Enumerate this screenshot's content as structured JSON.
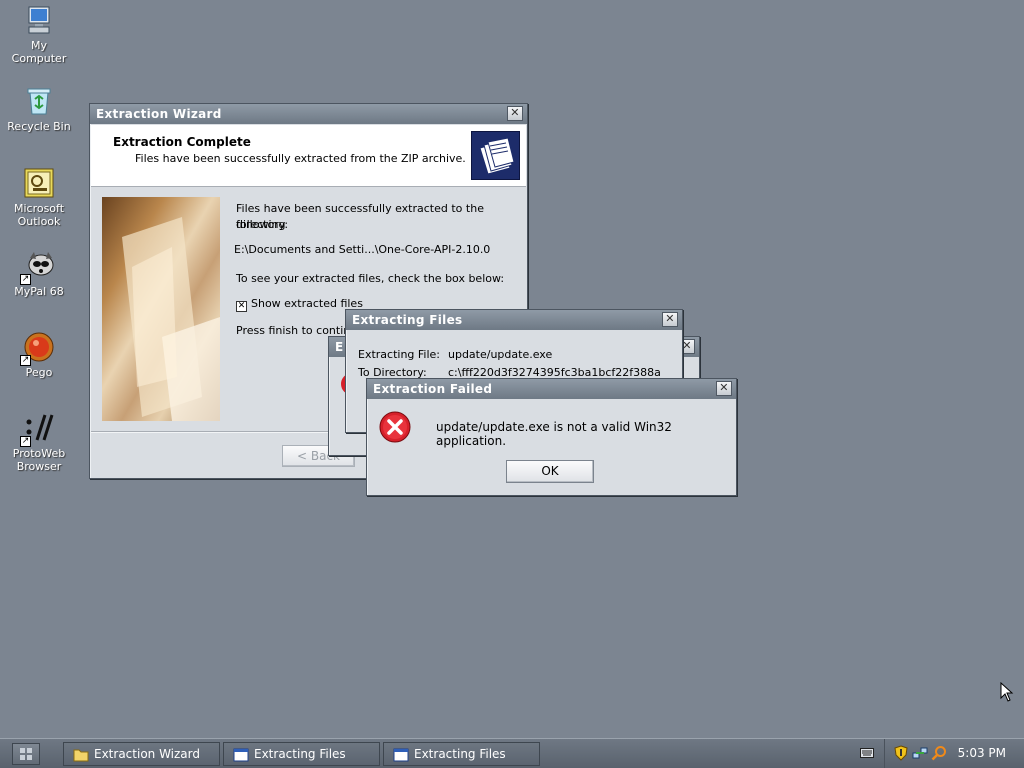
{
  "desktop_icons": [
    {
      "name": "my-computer-icon",
      "label": "My\nComputer"
    },
    {
      "name": "recycle-bin-icon",
      "label": "Recycle Bin"
    },
    {
      "name": "outlook-icon",
      "label": "Microsoft\nOutlook"
    },
    {
      "name": "mypal-icon",
      "label": "MyPal 68"
    },
    {
      "name": "pego-icon",
      "label": "Pego"
    },
    {
      "name": "protoweb-icon",
      "label": "ProtoWeb\nBrowser"
    }
  ],
  "wizard": {
    "title": "Extraction Wizard",
    "header_title": "Extraction Complete",
    "header_subtitle": "Files have been successfully extracted from the ZIP archive.",
    "body_line1": "Files have been successfully extracted to the following",
    "body_line2": "directory:",
    "directory": "E:\\Documents and Setti...\\One-Core-API-2.10.0",
    "check_prompt": "To see your extracted files, check the box below:",
    "checkbox_label": "Show extracted files",
    "finish_text": "Press finish to continu",
    "back_button": "< Back"
  },
  "extracting_back": {
    "title_letter": "E"
  },
  "extracting": {
    "title": "Extracting Files",
    "file_label": "Extracting File:",
    "file_value": "update/update.exe",
    "dir_label": "To Directory:",
    "dir_value": "c:\\fff220d3f3274395fc3ba1bcf22f388a"
  },
  "error_dialog": {
    "title": "Extraction Failed",
    "message": "update/update.exe is not a valid Win32 application.",
    "ok_button": "OK"
  },
  "taskbar": {
    "tasks": [
      {
        "label": "Extraction Wizard",
        "icon": "folder-icon"
      },
      {
        "label": "Extracting Files",
        "icon": "window-icon"
      },
      {
        "label": "Extracting Files",
        "icon": "window-icon"
      }
    ],
    "clock": "5:03 PM"
  },
  "colors": {
    "desktop": "#7c8591",
    "titlebar": "#7a8591",
    "error_red": "#d6202a"
  }
}
